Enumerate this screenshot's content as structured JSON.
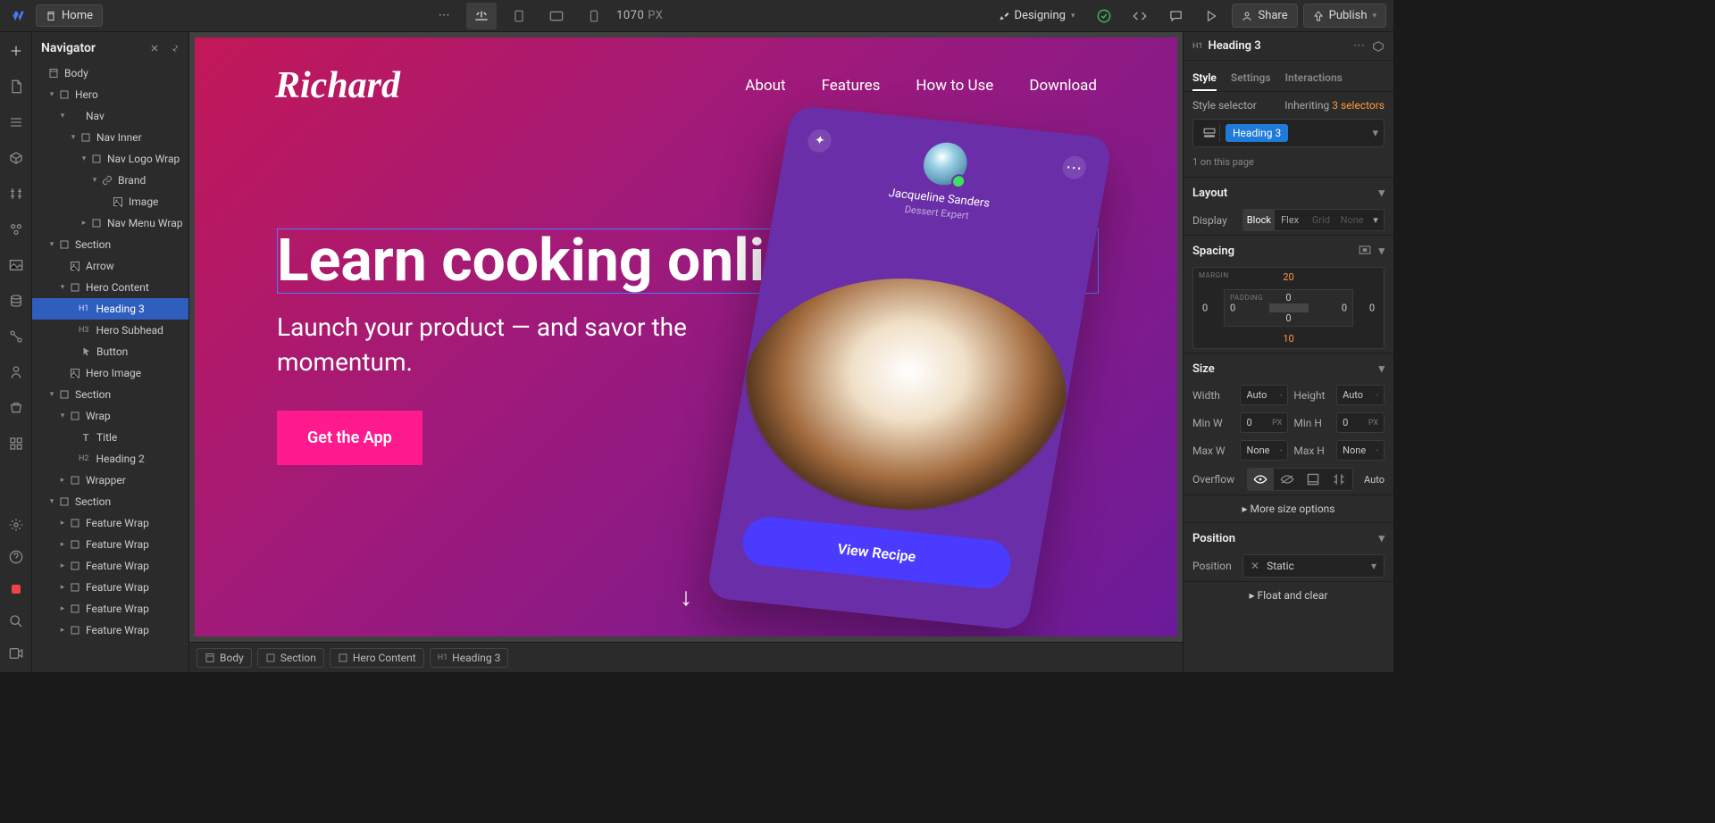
{
  "topbar": {
    "home": "Home",
    "viewport_value": "1070",
    "viewport_unit": "PX",
    "mode": "Designing",
    "share": "Share",
    "publish": "Publish"
  },
  "navigator": {
    "title": "Navigator",
    "tree": [
      {
        "i": 0,
        "a": "",
        "t": "page",
        "l": "Body"
      },
      {
        "i": 1,
        "a": "v",
        "t": "box",
        "l": "Hero"
      },
      {
        "i": 2,
        "a": "v",
        "t": "nav",
        "l": "Nav"
      },
      {
        "i": 3,
        "a": "v",
        "t": "box",
        "l": "Nav Inner"
      },
      {
        "i": 4,
        "a": "v",
        "t": "box",
        "l": "Nav Logo Wrap"
      },
      {
        "i": 5,
        "a": "v",
        "t": "link",
        "l": "Brand"
      },
      {
        "i": 6,
        "a": "",
        "t": "img",
        "l": "Image"
      },
      {
        "i": 4,
        "a": ">",
        "t": "box",
        "l": "Nav Menu Wrap"
      },
      {
        "i": 1,
        "a": "v",
        "t": "box",
        "l": "Section"
      },
      {
        "i": 2,
        "a": "",
        "t": "img",
        "l": "Arrow"
      },
      {
        "i": 2,
        "a": "v",
        "t": "box",
        "l": "Hero Content"
      },
      {
        "i": 3,
        "a": "",
        "t": "h",
        "tag": "H1",
        "l": "Heading 3",
        "sel": true
      },
      {
        "i": 3,
        "a": "",
        "t": "h",
        "tag": "H3",
        "l": "Hero Subhead"
      },
      {
        "i": 3,
        "a": "",
        "t": "btn",
        "l": "Button"
      },
      {
        "i": 2,
        "a": "",
        "t": "img",
        "l": "Hero Image"
      },
      {
        "i": 1,
        "a": "v",
        "t": "box",
        "l": "Section"
      },
      {
        "i": 2,
        "a": "v",
        "t": "box",
        "l": "Wrap"
      },
      {
        "i": 3,
        "a": "",
        "t": "t",
        "l": "Title"
      },
      {
        "i": 3,
        "a": "",
        "t": "h",
        "tag": "H2",
        "l": "Heading 2"
      },
      {
        "i": 2,
        "a": ">",
        "t": "box",
        "l": "Wrapper"
      },
      {
        "i": 1,
        "a": "v",
        "t": "box",
        "l": "Section"
      },
      {
        "i": 2,
        "a": ">",
        "t": "box",
        "l": "Feature Wrap"
      },
      {
        "i": 2,
        "a": ">",
        "t": "box",
        "l": "Feature Wrap"
      },
      {
        "i": 2,
        "a": ">",
        "t": "box",
        "l": "Feature Wrap"
      },
      {
        "i": 2,
        "a": ">",
        "t": "box",
        "l": "Feature Wrap"
      },
      {
        "i": 2,
        "a": ">",
        "t": "box",
        "l": "Feature Wrap"
      },
      {
        "i": 2,
        "a": ">",
        "t": "box",
        "l": "Feature Wrap"
      }
    ]
  },
  "canvas": {
    "logo": "Richard",
    "menu": [
      "About",
      "Features",
      "How to Use",
      "Download"
    ],
    "h1": "Learn cooking online",
    "sub": "Launch your product — and savor the momentum.",
    "cta": "Get the App",
    "phone": {
      "user": "Jacqueline Sanders",
      "role": "Dessert Expert",
      "btn": "View Recipe"
    }
  },
  "crumbs": [
    {
      "t": "page",
      "l": "Body"
    },
    {
      "t": "box",
      "l": "Section"
    },
    {
      "t": "box",
      "l": "Hero Content"
    },
    {
      "t": "h",
      "tag": "H1",
      "l": "Heading 3"
    }
  ],
  "rpanel": {
    "selected_tag": "H1",
    "selected_name": "Heading 3",
    "tabs": [
      "Style",
      "Settings",
      "Interactions"
    ],
    "selector_label": "Style selector",
    "inheriting_prefix": "Inheriting",
    "inheriting_link": "3 selectors",
    "chip": "Heading 3",
    "on_page": "1 on this page",
    "layout": {
      "title": "Layout",
      "display_label": "Display",
      "options": [
        "Block",
        "Flex",
        "Grid",
        "None"
      ]
    },
    "spacing": {
      "title": "Spacing",
      "margin_label": "MARGIN",
      "padding_label": "PADDING",
      "m_top": "20",
      "m_right": "0",
      "m_bottom": "10",
      "m_left": "0",
      "p_top": "0",
      "p_right": "0",
      "p_bottom": "0",
      "p_left": "0"
    },
    "size": {
      "title": "Size",
      "width_l": "Width",
      "width_v": "Auto",
      "height_l": "Height",
      "height_v": "Auto",
      "minw_l": "Min W",
      "minw_v": "0",
      "minw_u": "PX",
      "minh_l": "Min H",
      "minh_v": "0",
      "minh_u": "PX",
      "maxw_l": "Max W",
      "maxw_v": "None",
      "maxh_l": "Max H",
      "maxh_v": "None",
      "overflow_l": "Overflow",
      "overflow_auto": "Auto",
      "more": "More size options"
    },
    "position": {
      "title": "Position",
      "label": "Position",
      "value": "Static",
      "float": "Float and clear"
    }
  }
}
